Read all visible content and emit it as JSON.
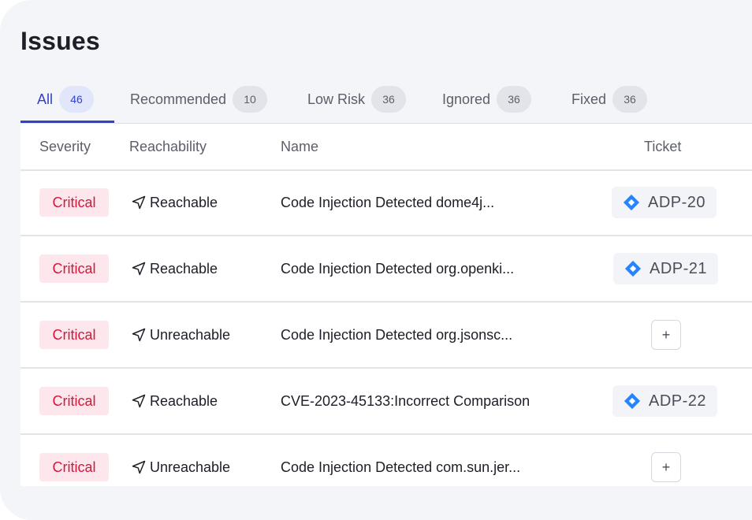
{
  "page": {
    "title": "Issues"
  },
  "tabs": [
    {
      "label": "All",
      "count": "46",
      "active": true
    },
    {
      "label": "Recommended",
      "count": "10"
    },
    {
      "label": "Low Risk",
      "count": "36"
    },
    {
      "label": "Ignored",
      "count": "36"
    },
    {
      "label": "Fixed",
      "count": "36"
    }
  ],
  "table": {
    "headers": {
      "severity": "Severity",
      "reachability": "Reachability",
      "name": "Name",
      "ticket": "Ticket"
    },
    "rows": [
      {
        "severity": "Critical",
        "reachability": "Reachable",
        "name": "Code Injection Detected dome4j...",
        "ticket": "ADP-20"
      },
      {
        "severity": "Critical",
        "reachability": "Reachable",
        "name": "Code Injection Detected org.openki...",
        "ticket": "ADP-21"
      },
      {
        "severity": "Critical",
        "reachability": "Unreachable",
        "name": "Code Injection Detected org.jsonsc...",
        "ticket": null,
        "add_label": "+"
      },
      {
        "severity": "Critical",
        "reachability": "Reachable",
        "name": "CVE-2023-45133:Incorrect Comparison",
        "ticket": "ADP-22"
      },
      {
        "severity": "Critical",
        "reachability": "Unreachable",
        "name": "Code Injection Detected com.sun.jer...",
        "ticket": null,
        "add_label": "+"
      }
    ]
  },
  "icons": {
    "reachability": "navigation-arrow-icon",
    "ticket": "jira-icon"
  },
  "colors": {
    "accent": "#3241c9",
    "critical": "#d6163a",
    "critical_bg": "#fde7ec",
    "jira": "#2684ff"
  }
}
